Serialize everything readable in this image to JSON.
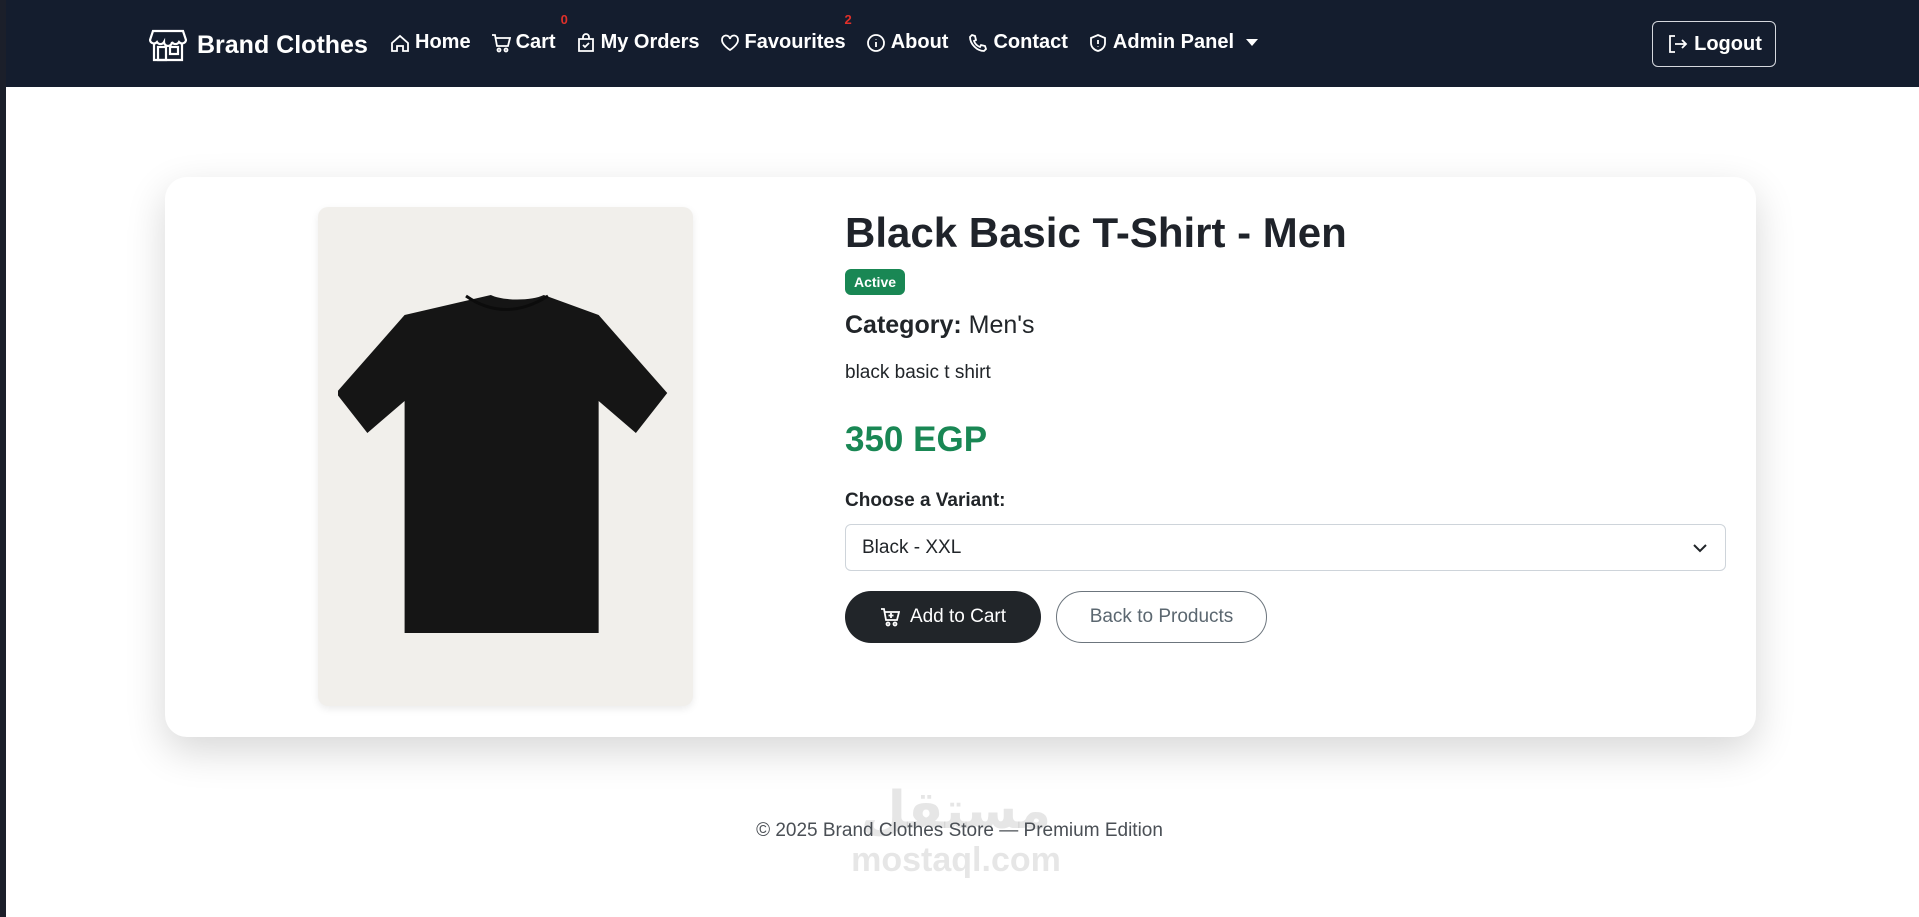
{
  "navbar": {
    "brand": "Brand Clothes",
    "links": [
      {
        "label": "Home",
        "icon": "home-icon"
      },
      {
        "label": "Cart",
        "icon": "cart-icon",
        "badge": "0"
      },
      {
        "label": "My Orders",
        "icon": "bag-check-icon"
      },
      {
        "label": "Favourites",
        "icon": "heart-icon",
        "badge": "2"
      },
      {
        "label": "About",
        "icon": "info-icon"
      },
      {
        "label": "Contact",
        "icon": "phone-icon"
      },
      {
        "label": "Admin Panel",
        "icon": "shield-icon"
      }
    ],
    "logout": "Logout"
  },
  "product": {
    "title": "Black Basic T-Shirt - Men",
    "status": "Active",
    "category_label": "Category:",
    "category": "Men's",
    "description": "black basic t shirt",
    "price": "350 EGP",
    "variant_label": "Choose a Variant:",
    "variant_selected": "Black - XXL",
    "add_to_cart": "Add to Cart",
    "back": "Back to Products"
  },
  "footer": {
    "text": "© 2025 Brand Clothes Store — Premium Edition"
  },
  "watermark": {
    "arabic": "مستقل",
    "latin": "mostaql.com"
  },
  "colors": {
    "navbar_bg": "#141d2e",
    "success": "#198754",
    "badge_red": "#e0302a",
    "dark_button": "#212529"
  }
}
